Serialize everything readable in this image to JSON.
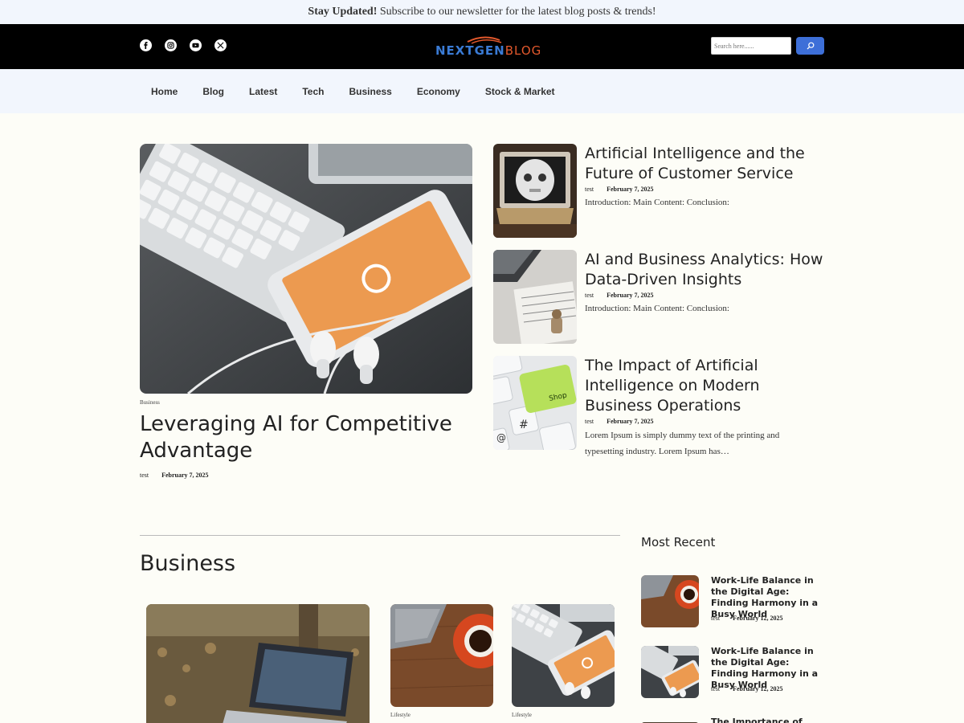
{
  "topbar": {
    "bold": "Stay Updated!",
    "text": " Subscribe to our newsletter for the latest blog posts & trends!"
  },
  "header": {
    "socials": [
      "facebook-icon",
      "instagram-icon",
      "youtube-icon",
      "x-icon"
    ],
    "logo_primary": "NEXTGEN",
    "logo_secondary": "BLOG",
    "search_placeholder": "Search here......"
  },
  "nav": [
    "Home",
    "Blog",
    "Latest",
    "Tech",
    "Business",
    "Economy",
    "Stock & Market"
  ],
  "hero": {
    "category": "Business",
    "title": "Leveraging AI for Competitive Advantage",
    "author": "test",
    "date": "February 7, 2025"
  },
  "side_posts": [
    {
      "title": "Artificial Intelligence and the Future of Customer Service",
      "author": "test",
      "date": "February 7, 2025",
      "excerpt": "Introduction: Main Content: Conclusion:"
    },
    {
      "title": "AI and Business Analytics: How Data-Driven Insights",
      "author": "test",
      "date": "February 7, 2025",
      "excerpt": "Introduction: Main Content: Conclusion:"
    },
    {
      "title": "The Impact of Artificial Intelligence on Modern Business Operations",
      "author": "test",
      "date": "February 7, 2025",
      "excerpt": "Lorem Ipsum is simply dummy text of the printing and typesetting industry. Lorem Ipsum has…"
    }
  ],
  "business": {
    "title": "Business",
    "cards": [
      {
        "category": ""
      },
      {
        "category": "Lifestyle"
      },
      {
        "category": "Lifestyle"
      }
    ]
  },
  "recent": {
    "title": "Most Recent",
    "items": [
      {
        "title": "Work-Life Balance in the Digital Age: Finding Harmony in a Busy World",
        "author": "test",
        "date": "February 12, 2025"
      },
      {
        "title": "Work-Life Balance in the Digital Age: Finding Harmony in a Busy World",
        "author": "test",
        "date": "February 12, 2025"
      },
      {
        "title": "The Importance of Self-",
        "author": "",
        "date": ""
      }
    ]
  },
  "colors": {
    "accent": "#3d6fd8",
    "logo_blue": "#3a7bd5",
    "logo_orange": "#e2582c",
    "header_bg": "#000000",
    "nav_bg": "#f2f6fd"
  }
}
